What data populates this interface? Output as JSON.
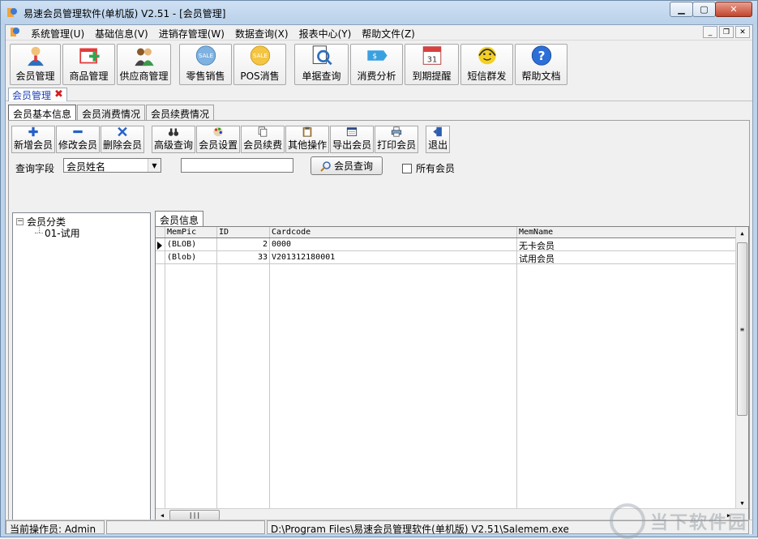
{
  "window": {
    "title": "易速会员管理软件(单机版) V2.51 - [会员管理]",
    "icons": [
      "app-icon",
      "minimize-icon",
      "maximize-icon",
      "close-icon"
    ]
  },
  "menu": {
    "items": [
      "系统管理(U)",
      "基础信息(V)",
      "进销存管理(W)",
      "数据查询(X)",
      "报表中心(Y)",
      "帮助文件(Z)"
    ]
  },
  "main_toolbar": {
    "groups": [
      [
        {
          "label": "会员管理",
          "icon": "member-icon"
        },
        {
          "label": "商品管理",
          "icon": "product-calendar-icon"
        },
        {
          "label": "供应商管理",
          "icon": "supplier-icon"
        }
      ],
      [
        {
          "label": "零售销售",
          "icon": "sale-badge-icon"
        },
        {
          "label": "POS消售",
          "icon": "pos-sale-icon"
        }
      ],
      [
        {
          "label": "单据查询",
          "icon": "document-search-icon"
        },
        {
          "label": "消费分析",
          "icon": "price-tag-icon"
        },
        {
          "label": "到期提醒",
          "icon": "calendar-icon"
        },
        {
          "label": "短信群发",
          "icon": "headset-icon"
        },
        {
          "label": "帮助文档",
          "icon": "help-icon"
        }
      ]
    ]
  },
  "doc_tab": {
    "label": "会员管理"
  },
  "sub_tabs": [
    "会员基本信息",
    "会员消费情况",
    "会员续费情况"
  ],
  "sub_toolbar": {
    "buttons": [
      {
        "label": "新增会员",
        "icon": "plus-icon"
      },
      {
        "label": "修改会员",
        "icon": "minus-icon"
      },
      {
        "label": "删除会员",
        "icon": "cross-icon"
      },
      {
        "label": "高级查询",
        "icon": "binoculars-icon"
      },
      {
        "label": "会员设置",
        "icon": "palette-icon"
      },
      {
        "label": "会员续费",
        "icon": "copy-icon"
      },
      {
        "label": "其他操作",
        "icon": "clipboard-icon"
      },
      {
        "label": "导出会员",
        "icon": "export-icon"
      },
      {
        "label": "打印会员",
        "icon": "printer-icon"
      },
      {
        "label": "退出",
        "icon": "exit-door-icon"
      }
    ]
  },
  "query": {
    "field_label": "查询字段",
    "field_value": "会员姓名",
    "input_value": "",
    "button_label": "会员查询",
    "all_members_label": "所有会员",
    "all_members_checked": false
  },
  "tree": {
    "root_label": "会员分类",
    "children": [
      "01-试用"
    ]
  },
  "grid": {
    "tab_label": "会员信息",
    "columns": [
      "MemPic",
      "ID",
      "Cardcode",
      "MemName"
    ],
    "rows": [
      [
        "(BLOB)",
        "2",
        "0000",
        "无卡会员"
      ],
      [
        "(Blob)",
        "33",
        "V201312180001",
        "试用会员"
      ]
    ],
    "current_row": 0
  },
  "status": {
    "operator": "当前操作员: Admin",
    "path": "D:\\Program Files\\易速会员管理软件(单机版) V2.51\\Salemem.exe"
  },
  "watermark": {
    "text": "当下软件园"
  }
}
